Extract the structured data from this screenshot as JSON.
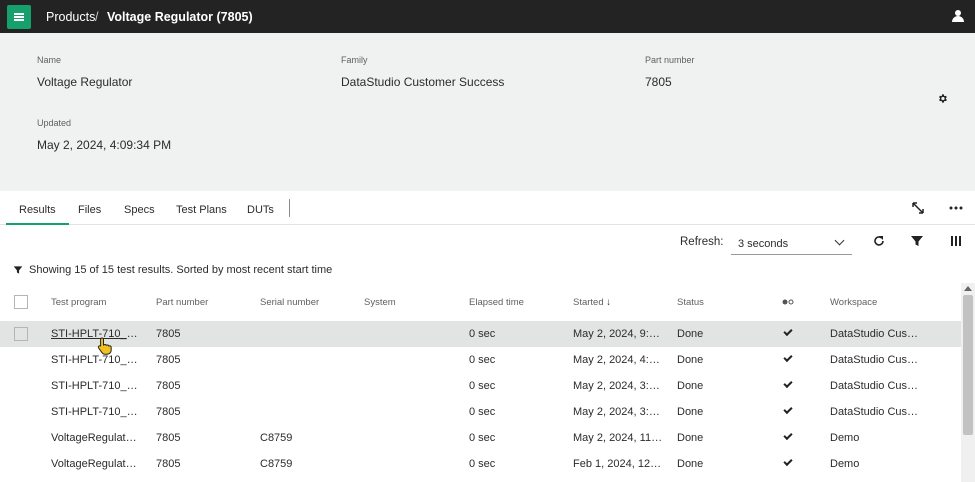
{
  "topbar": {
    "breadcrumb_parent": "Products",
    "breadcrumb_separator": "/",
    "breadcrumb_current": "Voltage Regulator (7805)",
    "menu_icon": "hamburger-icon",
    "user_icon": "user-icon"
  },
  "details": {
    "name_label": "Name",
    "name_value": "Voltage Regulator",
    "family_label": "Family",
    "family_value": "DataStudio Customer Success",
    "part_label": "Part number",
    "part_value": "7805",
    "updated_label": "Updated",
    "updated_value": "May 2, 2024, 4:09:34 PM",
    "settings_icon": "gear-icon"
  },
  "tabs": [
    "Results",
    "Files",
    "Specs",
    "Test Plans",
    "DUTs"
  ],
  "active_tab": "Results",
  "toolbar": {
    "refresh_label": "Refresh:",
    "refresh_value": "3 seconds"
  },
  "summary": "Showing 15 of 15 test results. Sorted by most recent start time",
  "table": {
    "columns": [
      "Test program",
      "Part number",
      "Serial number",
      "System",
      "Elapsed time",
      "Started",
      "Status",
      "",
      "Workspace"
    ],
    "sort_indicator": "↓",
    "rows": [
      {
        "program": "STI-HPLT-710_S…",
        "part": "7805",
        "serial": "",
        "system": "",
        "elapsed": "0 sec",
        "started": "May 2, 2024, 9:2…",
        "status": "Done",
        "workspace": "DataStudio Cus…"
      },
      {
        "program": "STI-HPLT-710_S…",
        "part": "7805",
        "serial": "",
        "system": "",
        "elapsed": "0 sec",
        "started": "May 2, 2024, 4:0…",
        "status": "Done",
        "workspace": "DataStudio Cus…"
      },
      {
        "program": "STI-HPLT-710_S…",
        "part": "7805",
        "serial": "",
        "system": "",
        "elapsed": "0 sec",
        "started": "May 2, 2024, 3:4…",
        "status": "Done",
        "workspace": "DataStudio Cus…"
      },
      {
        "program": "STI-HPLT-710_S…",
        "part": "7805",
        "serial": "",
        "system": "",
        "elapsed": "0 sec",
        "started": "May 2, 2024, 3:3…",
        "status": "Done",
        "workspace": "DataStudio Cus…"
      },
      {
        "program": "VoltageRegulat…",
        "part": "7805",
        "serial": "C8759",
        "system": "",
        "elapsed": "0 sec",
        "started": "May 2, 2024, 11:…",
        "status": "Done",
        "workspace": "Demo"
      },
      {
        "program": "VoltageRegulat…",
        "part": "7805",
        "serial": "C8759",
        "system": "",
        "elapsed": "0 sec",
        "started": "Feb 1, 2024, 12:…",
        "status": "Done",
        "workspace": "Demo"
      }
    ]
  },
  "colors": {
    "accent": "#16a06b",
    "topbar": "#232323",
    "panel": "#f0f1f1",
    "row_highlight": "#e2e3e3"
  }
}
